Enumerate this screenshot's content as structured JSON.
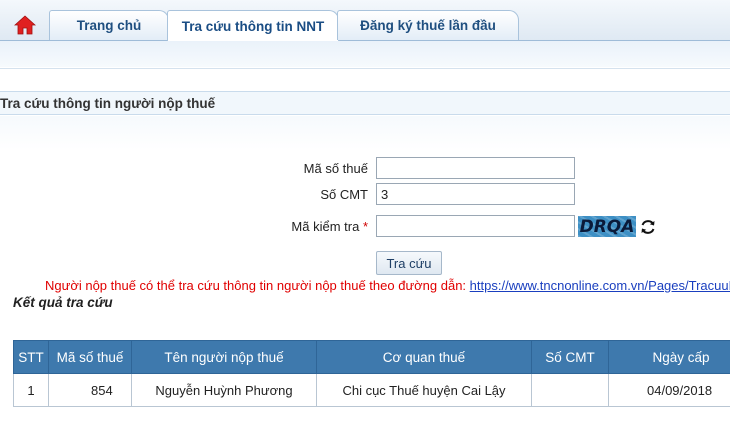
{
  "nav": {
    "tabs": [
      {
        "label": "Trang chủ",
        "active": false
      },
      {
        "label": "Tra cứu thông tin NNT",
        "active": true
      },
      {
        "label": "Đăng ký thuế lần đầu",
        "active": false
      }
    ],
    "home_icon": "home-icon",
    "home_color": "#e02020"
  },
  "section": {
    "title": "Tra cứu thông tin người nộp thuế"
  },
  "form": {
    "tax_code": {
      "label": "Mã số thuế",
      "value": ""
    },
    "id_number": {
      "label": "Số CMT",
      "value": "3"
    },
    "captcha": {
      "label": "Mã kiểm tra",
      "required_mark": "*",
      "value": "",
      "image_text": "DRQA"
    },
    "submit_label": "Tra cứu"
  },
  "notice": {
    "text": "Người nộp thuế có thể tra cứu thông tin người nộp thuế theo đường dẫn:",
    "link": "https://www.tncnonline.com.vn/Pages/TracuuN"
  },
  "results": {
    "title": "Kết quả tra cứu",
    "columns": [
      "STT",
      "Mã số thuế",
      "Tên người nộp thuế",
      "Cơ quan thuế",
      "Số CMT",
      "Ngày cấp"
    ],
    "rows": [
      [
        "1",
        "854",
        "Nguyễn Huỳnh Phương",
        "Chi cục Thuế huyện Cai Lậy",
        "",
        "04/09/2018"
      ]
    ]
  },
  "colors": {
    "header_bg": "#3e79ad",
    "notice": "#e00000",
    "link": "#1a3fbf"
  }
}
